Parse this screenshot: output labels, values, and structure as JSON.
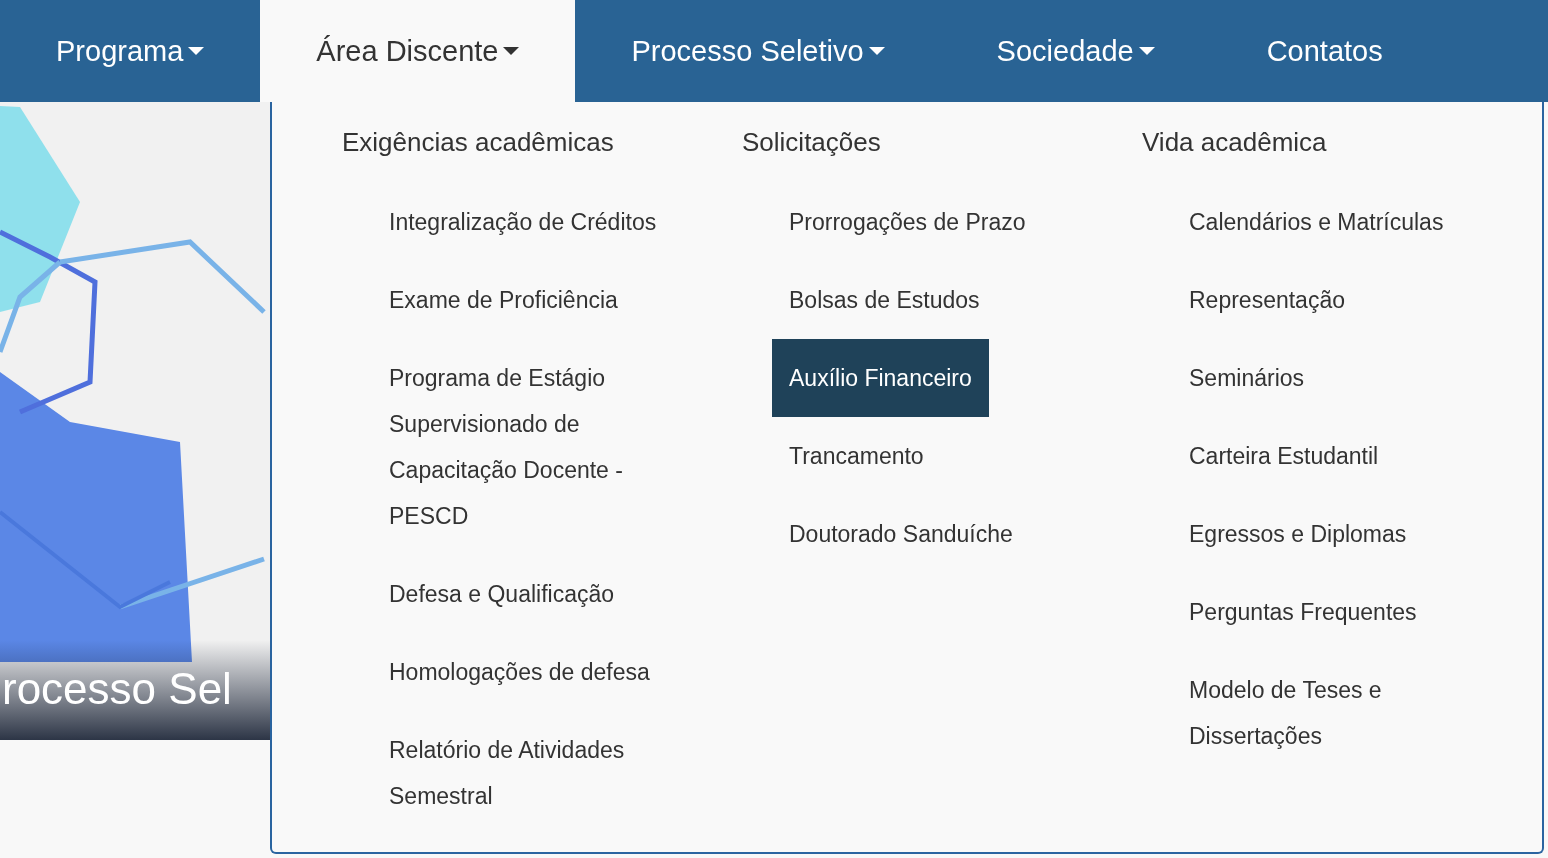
{
  "nav": [
    {
      "label": "Programa",
      "has_dropdown": true,
      "selected": false
    },
    {
      "label": "Área Discente",
      "has_dropdown": true,
      "selected": true
    },
    {
      "label": "Processo Seletivo",
      "has_dropdown": true,
      "selected": false
    },
    {
      "label": "Sociedade",
      "has_dropdown": true,
      "selected": false
    },
    {
      "label": "Contatos",
      "has_dropdown": false,
      "selected": false
    }
  ],
  "hero": {
    "caption": "rocesso Sel"
  },
  "dropdown": {
    "columns": [
      {
        "heading": "Exigências acadêmicas",
        "items": [
          {
            "label": "Integralização de Créditos",
            "selected": false
          },
          {
            "label": "Exame de Proficiência",
            "selected": false
          },
          {
            "label": "Programa de Estágio Supervisionado de Capacitação Docente - PESCD",
            "selected": false
          },
          {
            "label": "Defesa e Qualificação",
            "selected": false
          },
          {
            "label": "Homologações de defesa",
            "selected": false
          },
          {
            "label": "Relatório de Atividades Semestral",
            "selected": false
          }
        ]
      },
      {
        "heading": "Solicitações",
        "items": [
          {
            "label": "Prorrogações de Prazo",
            "selected": false
          },
          {
            "label": "Bolsas de Estudos",
            "selected": false
          },
          {
            "label": "Auxílio Financeiro",
            "selected": true
          },
          {
            "label": "Trancamento",
            "selected": false
          },
          {
            "label": "Doutorado Sanduíche",
            "selected": false
          }
        ]
      },
      {
        "heading": "Vida acadêmica",
        "items": [
          {
            "label": "Calendários e Matrículas",
            "selected": false
          },
          {
            "label": "Representação",
            "selected": false
          },
          {
            "label": "Seminários",
            "selected": false
          },
          {
            "label": "Carteira Estudantil",
            "selected": false
          },
          {
            "label": "Egressos e Diplomas",
            "selected": false
          },
          {
            "label": "Perguntas Frequentes",
            "selected": false
          },
          {
            "label": "Modelo de Teses e Dissertações",
            "selected": false
          }
        ]
      }
    ]
  }
}
